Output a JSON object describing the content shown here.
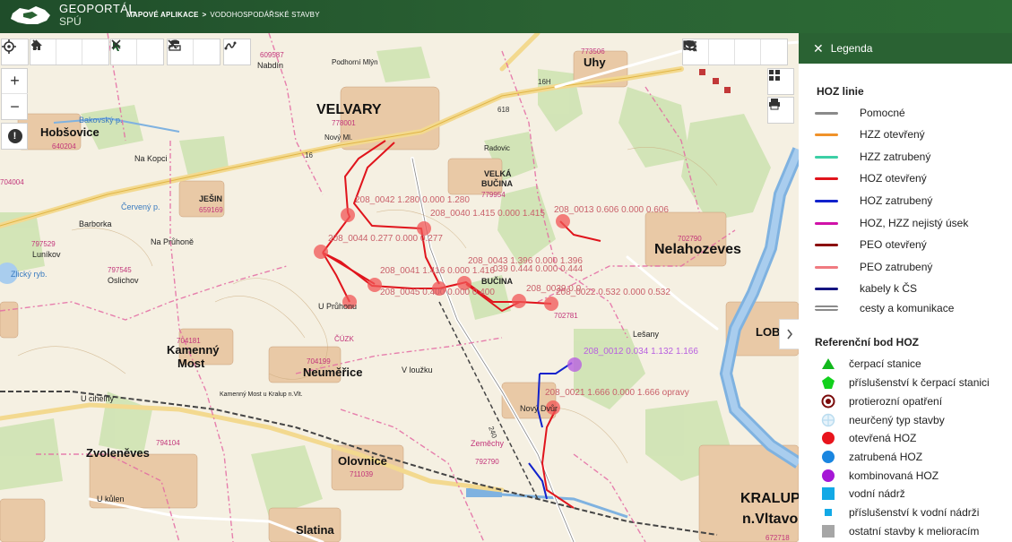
{
  "header": {
    "brand_line1": "GEOPORTÁL",
    "brand_line2": "SPÚ",
    "crumb1": "MAPOVÉ APLIKACE",
    "crumb_sep": ">",
    "crumb2": "VODOHOSPODÁŘSKÉ STAVBY"
  },
  "toolbar_left": {
    "locate_icon": "crosshair-icon",
    "back_icon": "chevron-left-icon",
    "forward_icon": "chevron-right-icon",
    "home_icon": "home-icon",
    "select_icon": "cursor-icon",
    "clear_icon": "close-icon",
    "measure_icon": "ruler-icon",
    "clear2_icon": "close-icon",
    "draw_icon": "draw-icon"
  },
  "zoom": {
    "in": "+",
    "out": "−",
    "info": "!"
  },
  "toolbar_right": {
    "search_icon": "search-icon",
    "search_map_icon": "search-map-icon",
    "list_icon": "list-icon",
    "layers_icon": "layers-icon",
    "grid_icon": "grid-icon",
    "print_icon": "print-icon"
  },
  "map": {
    "towns": {
      "velvary": "VELVARY",
      "nelahozeves": "Nelahozeves",
      "hobsovice": "Hobšovice",
      "kamenny_most_1": "Kamenný",
      "kamenny_most_2": "Most",
      "neumerice": "Neuměřice",
      "olovnice": "Olovnice",
      "zvoleneves": "Zvoleněves",
      "slatina": "Slatina",
      "kralupy_1": "KRALUP",
      "kralupy_2": "n.Vltavo",
      "lobec": "LOBEC",
      "uhy": "Uhy",
      "velka_bucina_1": "VELKÁ",
      "velka_bucina_2": "BUČINA",
      "bucina": "BUČINA",
      "u_prunovu": "U Průhonu",
      "lesany": "Lešany",
      "jesin": "JEŠIN",
      "lunikov": "Luníkov",
      "oslichov": "Oslichov",
      "nabdin": "Nabdín",
      "podhorni_mlyn": "Podhorní Mlýn",
      "na_kopci": "Na Kopci",
      "na_pruhone": "Na Průhoně",
      "barborka": "Barborka",
      "cerveny_p": "Červený p.",
      "bakovsky_p": "Bakovský p.",
      "zlicky_ryb": "Zlický ryb.",
      "v_louzku": "V loužku",
      "novy_dvur": "Nový Dvůr",
      "novy_mlyn": "Nový Ml.",
      "radovic": "Radovic",
      "u_kulen": "U kůlen",
      "zemechy": "Zeměchy",
      "cuzk": "ČÚZK",
      "u_cihelny": "U cihelny",
      "kamenny_most_rail": "Kamenný Most u Kralup n.Vlt."
    },
    "codes": [
      "609587",
      "773506",
      "778001",
      "779954",
      "640204",
      "659169",
      "797529",
      "797545",
      "704181",
      "704199",
      "794104",
      "711039",
      "702790",
      "702781",
      "792790",
      "672718",
      "704004"
    ],
    "route_labels": {
      "r1": "208_0042 1.280 0.000 1.280",
      "r2": "208_0040 1.415 0.000 1.415",
      "r3": "208_0044 0.277 0.000 0.277",
      "r4": "208_0041 1.416 0.000 1.416",
      "r5": "208_0043 1.396 0.000 1.396",
      "r6": "039 0.444 0.000 0.444",
      "r7": "208_0045 0.400 0.000 0.400",
      "r8": "208_0022 0.532 0.000 0.532",
      "r9": "208_0013 0.606 0.000 0.606",
      "r10": "208_0012 0.034 1.132 1.166",
      "r11": "208_0021 1.666 0.000 1.666 opravy",
      "r12": "208_0039 0.0"
    },
    "road_numbers": [
      "16",
      "16",
      "240",
      "16H",
      "618"
    ]
  },
  "legend": {
    "title": "Legenda",
    "section1": "HOZ linie",
    "lines": [
      {
        "label": "Pomocné",
        "color": "#8a8a8a"
      },
      {
        "label": "HZZ otevřený",
        "color": "#f0922a"
      },
      {
        "label": "HZZ zatrubený",
        "color": "#3ccfa5"
      },
      {
        "label": "HOZ otevřený",
        "color": "#e0141c"
      },
      {
        "label": "HOZ zatrubený",
        "color": "#1122cc"
      },
      {
        "label": "HOZ, HZZ nejistý úsek",
        "color": "#d012a8"
      },
      {
        "label": "PEO otevřený",
        "color": "#8b0a0a"
      },
      {
        "label": "PEO zatrubený",
        "color": "#f07a80"
      },
      {
        "label": "kabely k ČS",
        "color": "#141480"
      },
      {
        "label": "cesty a komunikace",
        "color": "#8a8a8a"
      }
    ],
    "section2": "Referenční bod HOZ",
    "points": [
      {
        "label": "čerpací stanice",
        "icon": "triangle-icon"
      },
      {
        "label": "příslušenství k čerpací stanici",
        "icon": "pentagon-icon"
      },
      {
        "label": "protierozní opatření",
        "icon": "ring-dot-icon"
      },
      {
        "label": "neurčený typ stavby",
        "icon": "crosshair-circle-icon"
      },
      {
        "label": "otevřená HOZ",
        "icon": "red-dot-icon"
      },
      {
        "label": "zatrubená HOZ",
        "icon": "blue-dot-icon"
      },
      {
        "label": "kombinovaná HOZ",
        "icon": "purple-dot-icon"
      },
      {
        "label": "vodní nádrž",
        "icon": "square-icon"
      },
      {
        "label": "příslušenství k vodní nádrži",
        "icon": "small-square-icon"
      },
      {
        "label": "ostatní stavby k melioracím",
        "icon": "gray-square-icon"
      }
    ]
  }
}
